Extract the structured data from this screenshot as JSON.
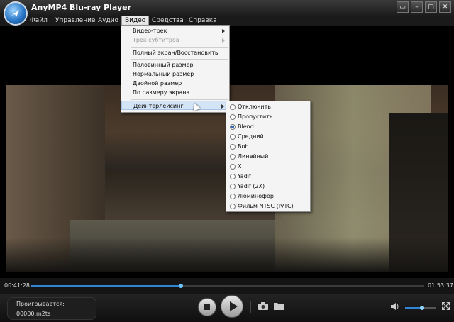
{
  "app": {
    "title": "AnyMP4 Blu-ray Player"
  },
  "window_buttons": [
    "▭",
    "–",
    "▢",
    "✕"
  ],
  "menubar": [
    "Файл",
    "Управление",
    "Аудио",
    "Видео",
    "Средства",
    "Справка"
  ],
  "video_menu": {
    "items": [
      {
        "label": "Видео-трек",
        "submenu": true,
        "disabled": false
      },
      {
        "label": "Трек субтитров",
        "submenu": true,
        "disabled": true
      },
      {
        "label": "Полный экран/Восстановить"
      },
      {
        "label": "Половинный размер"
      },
      {
        "label": "Нормальный размер"
      },
      {
        "label": "Двойной размер"
      },
      {
        "label": "По размеру экрана"
      },
      {
        "label": "Деинтерлейсинг",
        "submenu": true,
        "highlighted": true
      }
    ]
  },
  "deinterlace_menu": {
    "selected": "Blend",
    "items": [
      "Отключить",
      "Пропустить",
      "Blend",
      "Средний",
      "Bob",
      "Линейный",
      "X",
      "Yadif",
      "Yadif (2X)",
      "Люминофор",
      "Фильм NTSC (IVTC)"
    ]
  },
  "playback": {
    "current_time": "00:41:28",
    "total_time": "01:53:37",
    "progress": 0.38
  },
  "now_playing": {
    "label": "Проигрывается:",
    "file": "00000.m2ts"
  },
  "volume": {
    "level": 0.55
  },
  "colors": {
    "accent": "#2f86d6",
    "menu_bg": "#f4f4f4",
    "highlight": "#d3e4f6"
  }
}
